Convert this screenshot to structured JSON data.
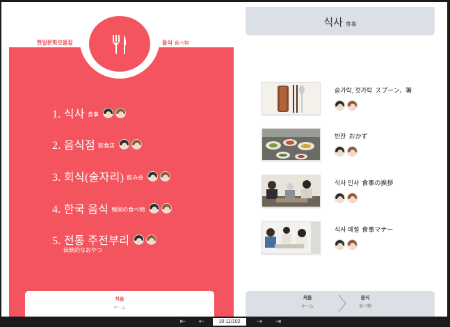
{
  "left": {
    "header_left": "한일문화모음집",
    "header_right": "음식",
    "header_right_sub": "食べ物",
    "items": [
      {
        "title": "1. 식사",
        "jp": "食事"
      },
      {
        "title": "2. 음식점",
        "jp": "飲食店"
      },
      {
        "title": "3. 회식(술자리)",
        "jp": "飲み会"
      },
      {
        "title": "4. 한국 음식",
        "jp": "韓国の食べ物"
      },
      {
        "title": "5. 전통 주전부리",
        "jp": "伝統的なおやつ"
      }
    ],
    "footer_label": "처음",
    "footer_sub": "ホーム"
  },
  "right": {
    "title": "식사",
    "title_sub": "食事",
    "topics": [
      {
        "title": "숟가락, 젓가락",
        "jp": "スプーン、箸",
        "thumb": "spoon-chopsticks-photo"
      },
      {
        "title": "반찬",
        "jp": "おかず",
        "thumb": "side-dishes-photo"
      },
      {
        "title": "식사 인사",
        "jp": "食事の挨拶",
        "thumb": "meal-greeting-photo"
      },
      {
        "title": "식사 예절",
        "jp": "食事マナー",
        "thumb": "meal-manners-photo"
      }
    ],
    "footer": {
      "home_label": "처음",
      "home_sub": "ホーム",
      "food_label": "음식",
      "food_sub": "食べ物"
    }
  },
  "nav": {
    "page_indicator": "10-11/102",
    "first_icon": "first-page-icon",
    "prev_icon": "prev-page-icon",
    "next_icon": "next-page-icon",
    "last_icon": "last-page-icon"
  },
  "colors": {
    "accent": "#f3545e",
    "panel_gray": "#dbe0e6",
    "bar": "#1b1b1b"
  }
}
